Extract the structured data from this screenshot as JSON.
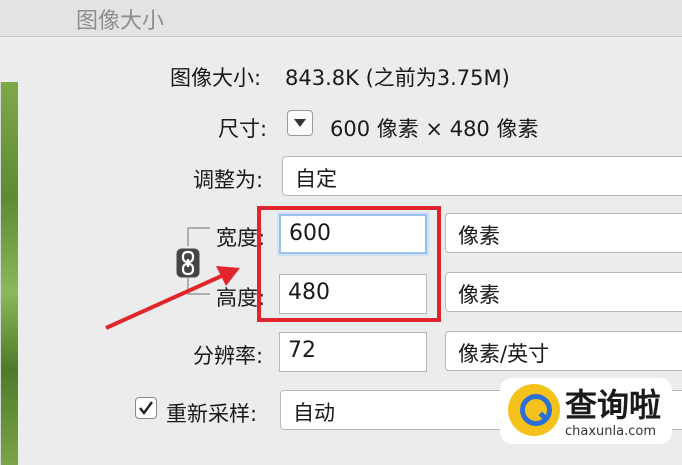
{
  "window": {
    "title": "图像大小"
  },
  "image_size": {
    "label": "图像大小:",
    "value": "843.8K (之前为3.75M)"
  },
  "dimensions": {
    "label": "尺寸:",
    "value": "600 像素 × 480 像素"
  },
  "fit_to": {
    "label": "调整为:",
    "value": "自定"
  },
  "width": {
    "label": "宽度:",
    "value": "600",
    "unit": "像素"
  },
  "height": {
    "label": "高度:",
    "value": "480",
    "unit": "像素"
  },
  "resolution": {
    "label": "分辨率:",
    "value": "72",
    "unit": "像素/英寸"
  },
  "resample": {
    "label": "重新采样:",
    "checked": true,
    "value": "自动"
  },
  "icons": {
    "dimensions_menu": "triangle-down-icon",
    "constrain": "link-chain-icon",
    "checkbox": "checkmark-icon"
  },
  "annotation": {
    "highlight_color": "#e0262b"
  },
  "watermark": {
    "name": "查询啦",
    "url": "chaxunla.com"
  }
}
